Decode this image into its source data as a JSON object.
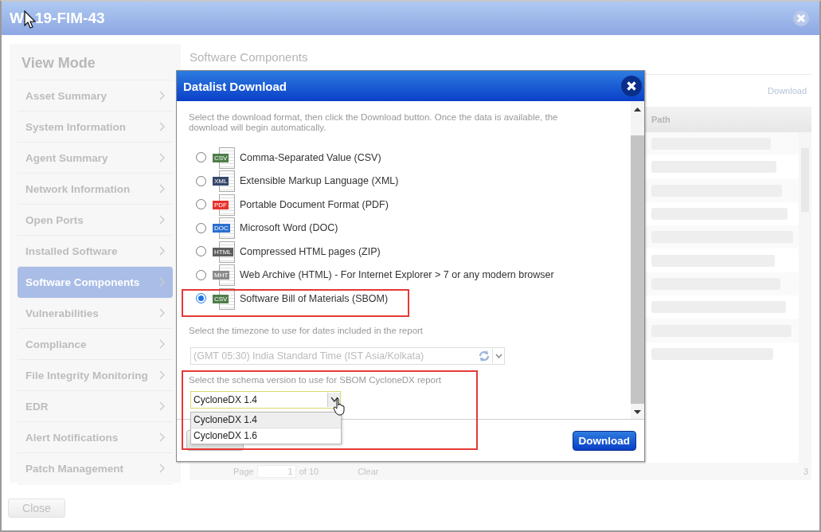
{
  "window": {
    "title_start": "W",
    "title_end": "19-FIM-43"
  },
  "sidebar": {
    "heading": "View Mode",
    "items": [
      {
        "label": "Asset Summary",
        "selected": false
      },
      {
        "label": "System Information",
        "selected": false
      },
      {
        "label": "Agent Summary",
        "selected": false
      },
      {
        "label": "Network Information",
        "selected": false
      },
      {
        "label": "Open Ports",
        "selected": false
      },
      {
        "label": "Installed Software",
        "selected": false
      },
      {
        "label": "Software Components",
        "selected": true
      },
      {
        "label": "Vulnerabilities",
        "selected": false
      },
      {
        "label": "Compliance",
        "selected": false
      },
      {
        "label": "File Integrity Monitoring",
        "selected": false
      },
      {
        "label": "EDR",
        "selected": false
      },
      {
        "label": "Alert Notifications",
        "selected": false
      },
      {
        "label": "Patch Management",
        "selected": false
      }
    ]
  },
  "content": {
    "title": "Software Components",
    "download_link": "Download",
    "column": "Path",
    "pager": {
      "page_label": "Page",
      "page_value": "1",
      "of": "of 10",
      "clear": "Clear",
      "count": "3"
    }
  },
  "close_button": "Close",
  "dialog": {
    "title": "Datalist Download",
    "intro": "Select the download format, then click the Download button. Once the data is available, the download will begin automatically.",
    "formats": [
      {
        "badge": "CSV",
        "label": "Comma-Separated Value (CSV)",
        "selected": false,
        "color": "#4f7d4a"
      },
      {
        "badge": "XML",
        "label": "Extensible Markup Language (XML)",
        "selected": false,
        "color": "#34466a"
      },
      {
        "badge": "PDF",
        "label": "Portable Document Format (PDF)",
        "selected": false,
        "color": "#e8302a"
      },
      {
        "badge": "DOC",
        "label": "Microsoft Word (DOC)",
        "selected": false,
        "color": "#2a6fd0"
      },
      {
        "badge": "HTML",
        "label": "Compressed HTML pages (ZIP)",
        "selected": false,
        "color": "#5f5f5f"
      },
      {
        "badge": "MHT",
        "label": "Web Archive (HTML) - For Internet Explorer > 7 or any modern browser",
        "selected": false,
        "color": "#8a8a8a"
      },
      {
        "badge": "CSV",
        "label": "Software Bill of Materials (SBOM)",
        "selected": true,
        "color": "#4f7d4a"
      }
    ],
    "timezone_label": "Select the timezone to use for dates included in the report",
    "timezone": {
      "value": "(GMT 05:30) India Standard Time (IST Asia/Kolkata)",
      "disabled": true
    },
    "schema_label": "Select the schema version to use for SBOM CycloneDX report",
    "schema": {
      "value": "CycloneDX 1.4",
      "expanded": true,
      "options": [
        {
          "label": "CycloneDX 1.4",
          "selected": true
        },
        {
          "label": "CycloneDX 1.6",
          "selected": false
        }
      ]
    },
    "download_button": "Download"
  }
}
